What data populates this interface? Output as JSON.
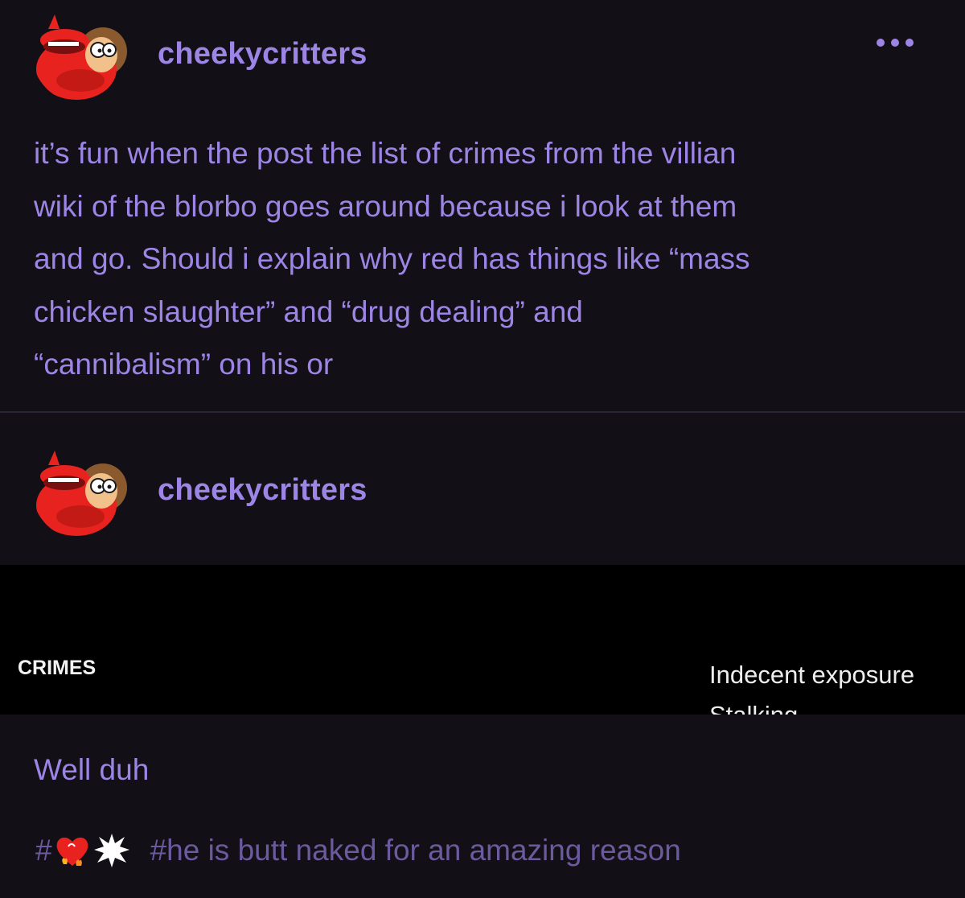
{
  "post": {
    "username": "cheekycritters",
    "avatar_icon": "cartoon-devil-avatar",
    "more_icon": "more-options-icon",
    "body_lines": [
      "it’s fun when the  post the list of crimes from the villian",
      "wiki of the blorbo goes around because i look at them",
      "and go. Should i explain why red has things like “mass",
      "chicken slaughter” and “drug dealing” and",
      "“cannibalism” on his or"
    ]
  },
  "reblog": {
    "username": "cheekycritters",
    "avatar_icon": "cartoon-devil-avatar",
    "embed": {
      "label": "CRIMES",
      "items": [
        "Indecent exposure",
        "Stalking"
      ]
    },
    "text": "Well duh",
    "tags": {
      "emoji_tag_prefix": "#",
      "emoji_tag_icons": [
        "burning-heart-icon",
        "explosion-icon"
      ],
      "text_tag": "#he is butt naked for an amazing reason"
    }
  },
  "colors": {
    "background": "#121016",
    "accent": "#9d85e6",
    "tag": "#6a5a9e",
    "avatar_red": "#e8231f"
  }
}
